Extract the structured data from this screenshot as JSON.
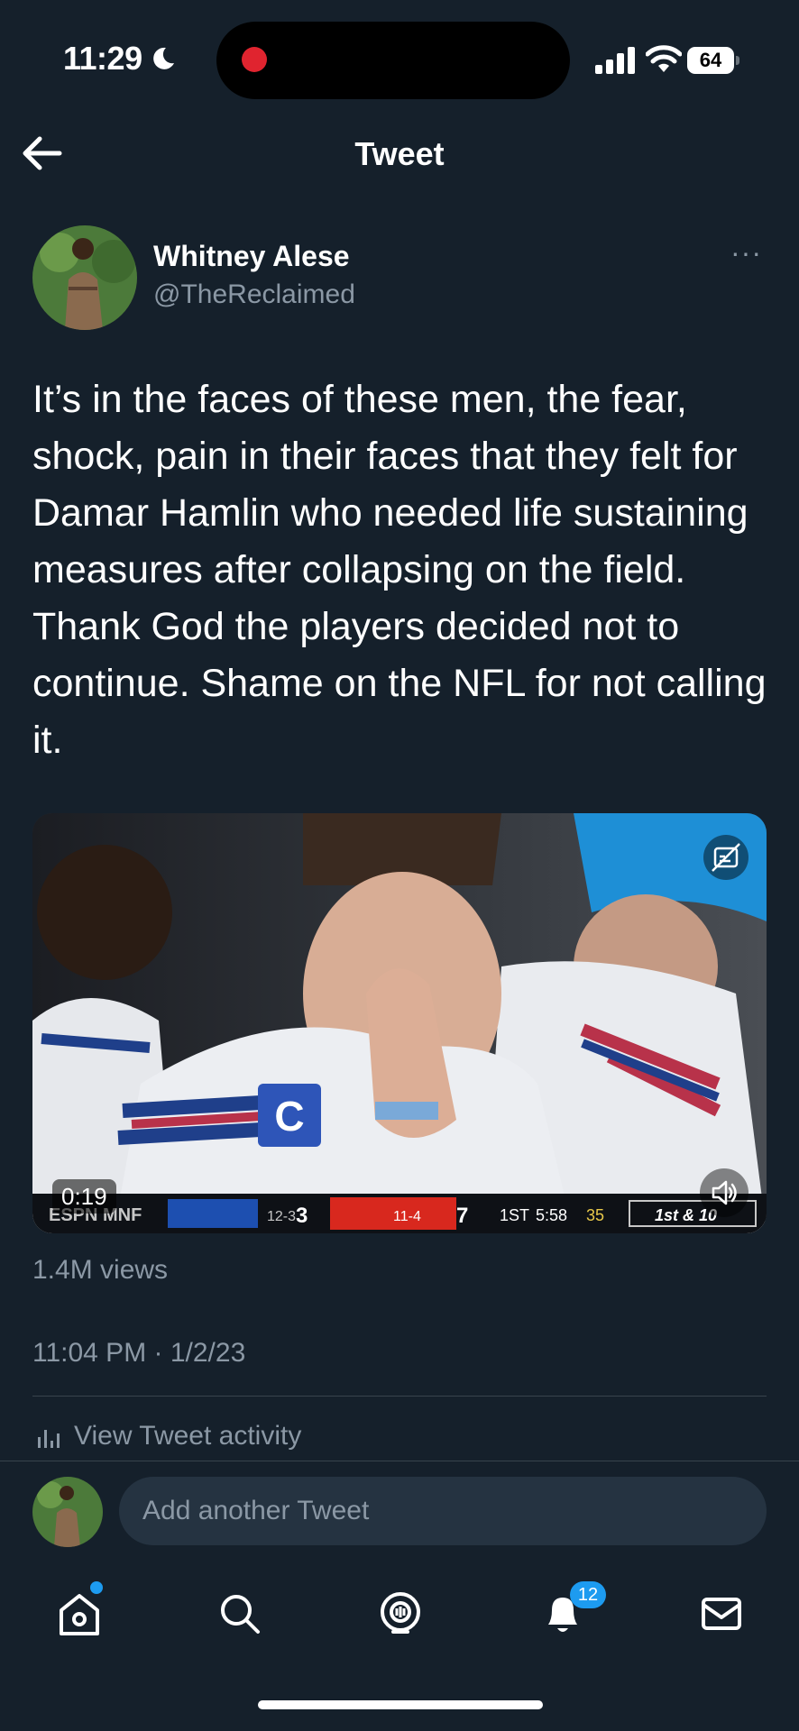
{
  "status_bar": {
    "time": "11:29",
    "battery": "64"
  },
  "header": {
    "title": "Tweet"
  },
  "author": {
    "name": "Whitney Alese",
    "handle": "@TheReclaimed"
  },
  "tweet": {
    "text": "It’s in the faces of these men, the fear, shock, pain in their faces that they felt for Damar Hamlin who needed life sustaining measures after collapsing on the field. Thank God the players decided not to continue. Shame on the NFL for not calling it."
  },
  "video": {
    "duration": "0:19",
    "scorebug": {
      "network": "ESPN MNF",
      "team1_record": "12-3",
      "team1_score": "3",
      "team2_record": "11-4",
      "team2_score": "7",
      "quarter": "1ST",
      "clock": "5:58",
      "play_clock": "35",
      "down": "1st & 10"
    }
  },
  "stats": {
    "views": "1.4M views",
    "timestamp": "11:04 PM · 1/2/23",
    "activity_label": "View Tweet activity"
  },
  "reply": {
    "placeholder": "Add another Tweet"
  },
  "nav": {
    "notifications_count": "12"
  },
  "colors": {
    "background": "#15202b",
    "accent": "#1d9bf0",
    "secondary_text": "#8b98a5"
  }
}
